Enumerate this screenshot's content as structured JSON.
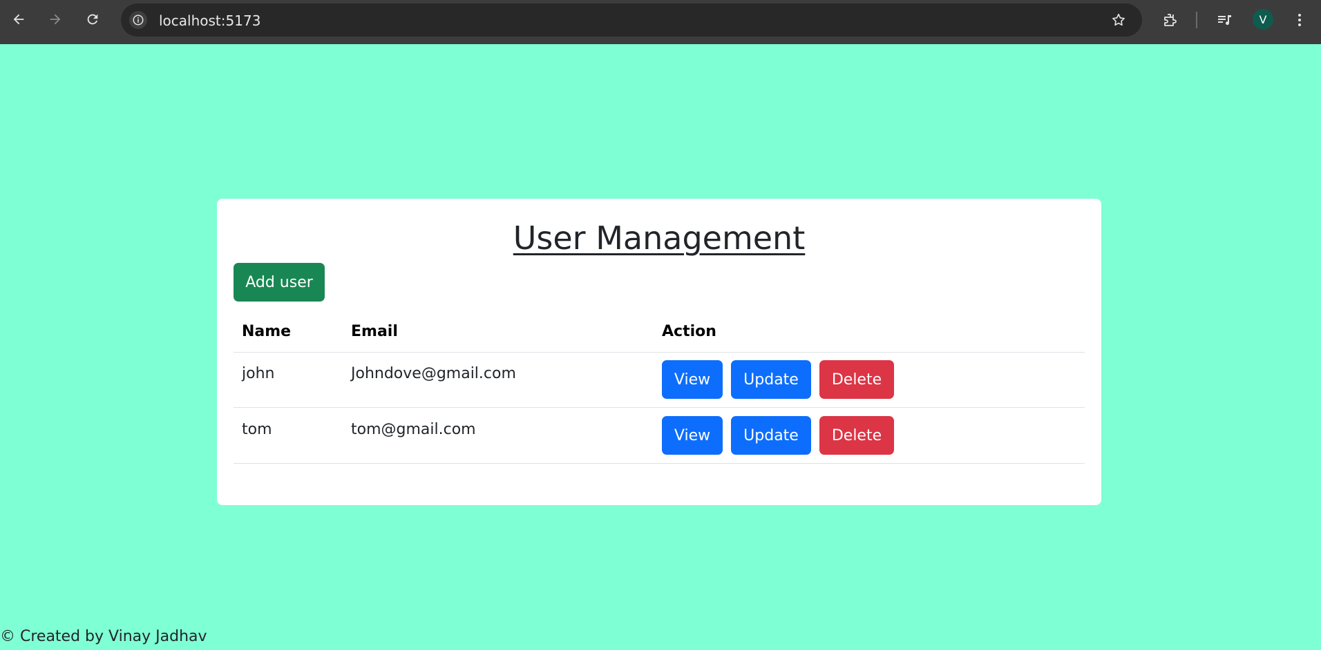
{
  "browser": {
    "url": "localhost:5173",
    "avatar_initial": "V",
    "icons": [
      "back-arrow-icon",
      "forward-arrow-icon",
      "reload-icon",
      "info-icon",
      "star-icon",
      "extensions-icon",
      "media-playlist-icon",
      "more-vert-icon"
    ]
  },
  "page": {
    "background_color": "#7fffd4",
    "title": "User Management",
    "add_button_label": "Add user",
    "table": {
      "headers": {
        "name": "Name",
        "email": "Email",
        "action": "Action"
      },
      "rows": [
        {
          "name": "john",
          "email": "Johndove@gmail.com",
          "view": "View",
          "update": "Update",
          "delete": "Delete"
        },
        {
          "name": "tom",
          "email": "tom@gmail.com",
          "view": "View",
          "update": "Update",
          "delete": "Delete"
        }
      ]
    },
    "footer": "© Created by Vinay Jadhav"
  },
  "colors": {
    "add_button": "#198754",
    "primary_button": "#0d6efd",
    "danger_button": "#dc3545"
  }
}
